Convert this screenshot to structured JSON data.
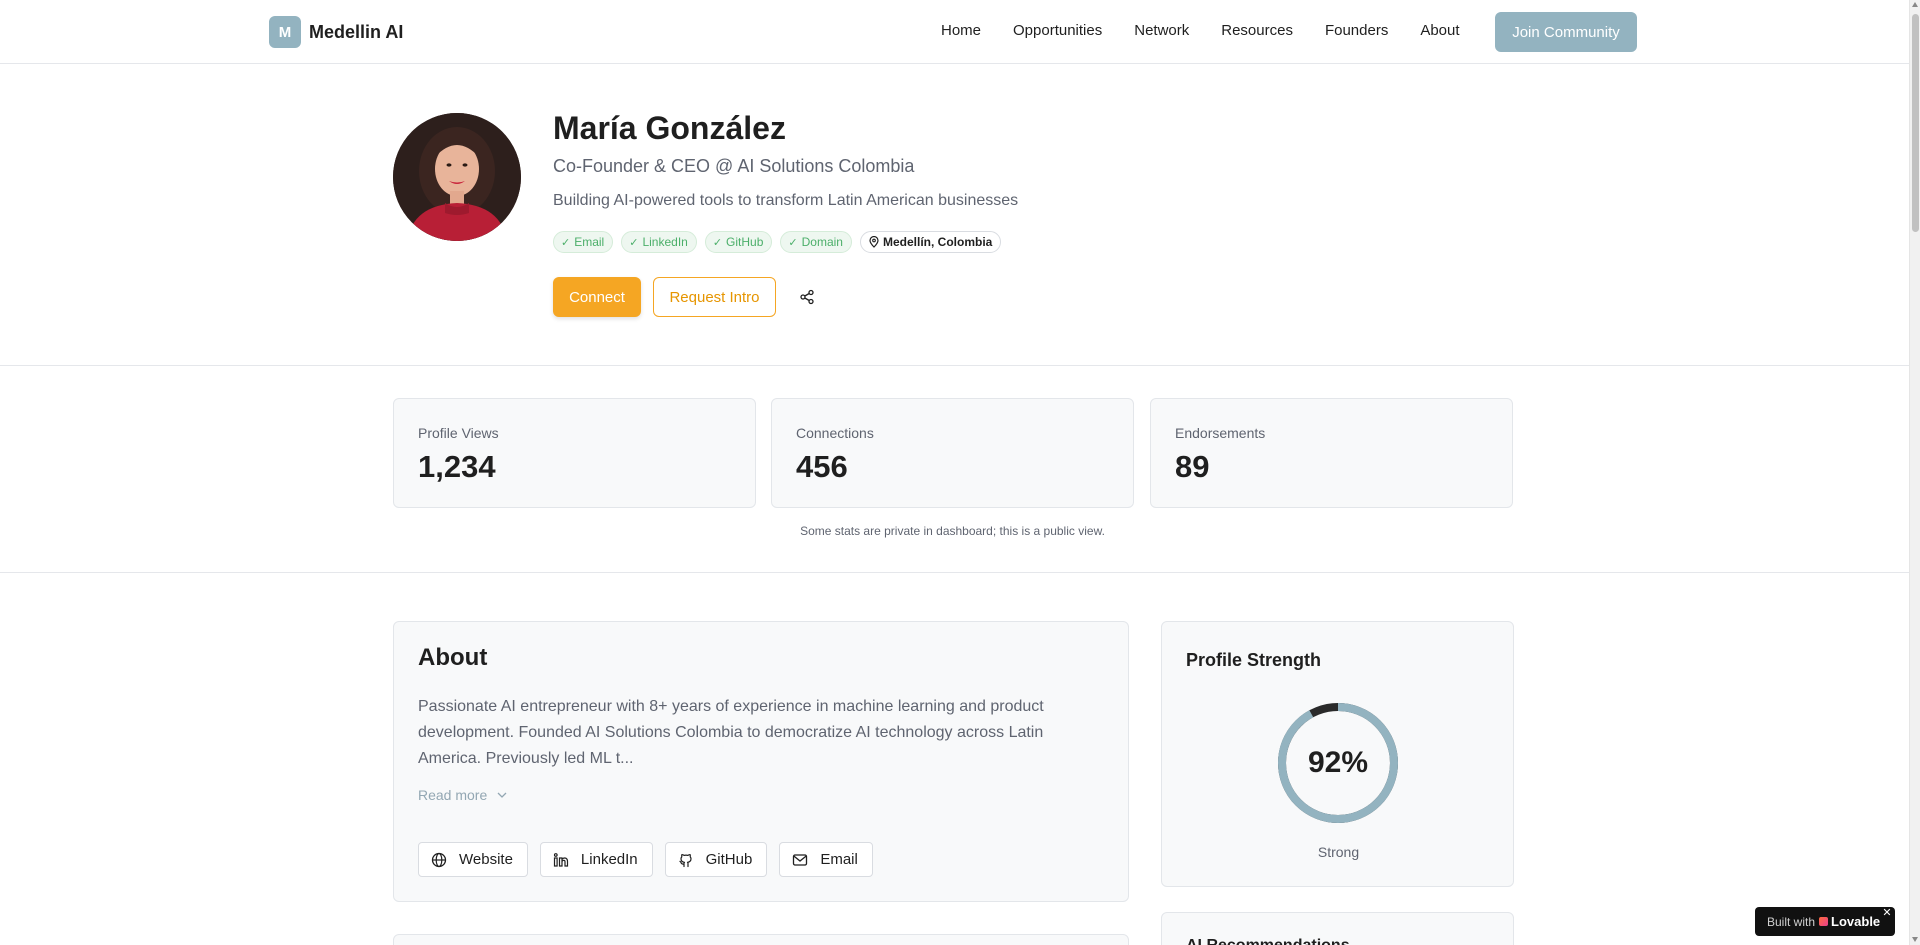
{
  "header": {
    "logo_letter": "M",
    "brand": "Medellin AI",
    "nav": [
      "Home",
      "Opportunities",
      "Network",
      "Resources",
      "Founders",
      "About"
    ],
    "cta": "Join Community"
  },
  "profile": {
    "name": "María González",
    "role": "Co-Founder & CEO @ AI Solutions Colombia",
    "tagline": "Building AI-powered tools to transform Latin American businesses",
    "badges": [
      "Email",
      "LinkedIn",
      "GitHub",
      "Domain"
    ],
    "location": "Medellín, Colombia",
    "connect_label": "Connect",
    "intro_label": "Request Intro"
  },
  "stats": {
    "items": [
      {
        "label": "Profile Views",
        "value": "1,234"
      },
      {
        "label": "Connections",
        "value": "456"
      },
      {
        "label": "Endorsements",
        "value": "89"
      }
    ],
    "note": "Some stats are private in dashboard; this is a public view."
  },
  "about": {
    "title": "About",
    "text": "Passionate AI entrepreneur with 8+ years of experience in machine learning and product development. Founded AI Solutions Colombia to democratize AI technology across Latin America. Previously led ML t...",
    "read_more": "Read more",
    "links": [
      "Website",
      "LinkedIn",
      "GitHub",
      "Email"
    ]
  },
  "strength": {
    "title": "Profile Strength",
    "percent_label": "92%",
    "percent": 92,
    "status": "Strong"
  },
  "recommendations": {
    "title": "AI Recommendations"
  },
  "lovable": {
    "prefix": "Built with",
    "brand": "Lovable"
  },
  "colors": {
    "accent": "#f5a623",
    "brand": "#93b3c0",
    "verified": "#4caf6a"
  }
}
